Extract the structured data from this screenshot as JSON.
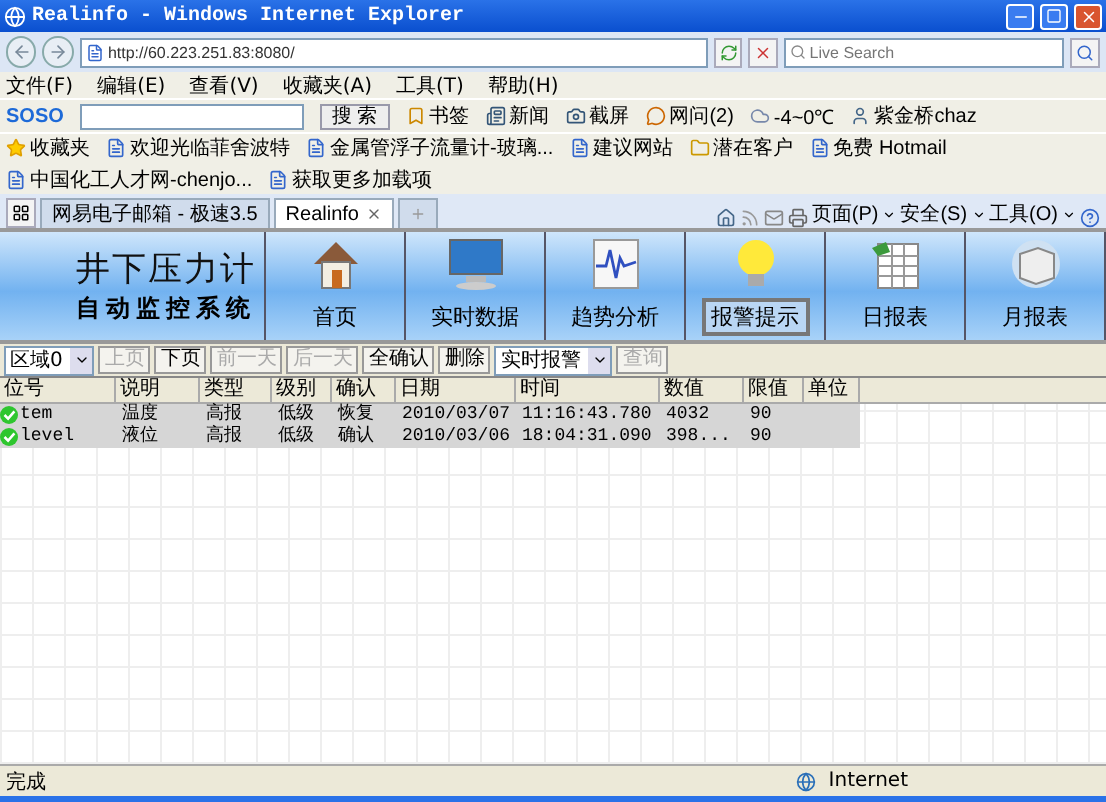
{
  "window": {
    "title": "Realinfo - Windows Internet Explorer"
  },
  "address_bar": {
    "url": "http://60.223.251.83:8080/",
    "search_placeholder": "Live Search"
  },
  "menu": [
    "文件(F)",
    "编辑(E)",
    "查看(V)",
    "收藏夹(A)",
    "工具(T)",
    "帮助(H)"
  ],
  "soso_toolbar": {
    "logo": "SOSO",
    "search_button": "搜 索",
    "items": [
      {
        "kind": "bookmark",
        "label": "书签"
      },
      {
        "kind": "news",
        "label": "新闻"
      },
      {
        "kind": "screenshot",
        "label": "截屏"
      },
      {
        "kind": "qa",
        "label": "网问(2)"
      },
      {
        "kind": "weather",
        "label": "-4~0℃"
      },
      {
        "kind": "user",
        "label": "紫金桥chaz"
      }
    ]
  },
  "favorites_bar": {
    "label": "收藏夹",
    "links": [
      {
        "kind": "page",
        "label": "欢迎光临菲舍波特"
      },
      {
        "kind": "page",
        "label": "金属管浮子流量计-玻璃..."
      },
      {
        "kind": "page",
        "label": "建议网站"
      },
      {
        "kind": "folder",
        "label": "潜在客户"
      },
      {
        "kind": "page",
        "label": "免费 Hotmail"
      },
      {
        "kind": "page",
        "label": "中国化工人才网-chenjo..."
      },
      {
        "kind": "page",
        "label": "获取更多加载项"
      }
    ]
  },
  "tabs": [
    {
      "label": "网易电子邮箱 - 极速3.5",
      "selected": false
    },
    {
      "label": "Realinfo",
      "selected": true
    }
  ],
  "command_bar": [
    "页面(P)",
    "安全(S)",
    "工具(O)"
  ],
  "app_header": {
    "title": "井下压力计",
    "subtitle": "自动监控系统",
    "nav": [
      {
        "kind": "home",
        "label": "首页",
        "selected": false
      },
      {
        "kind": "monitor",
        "label": "实时数据",
        "selected": false
      },
      {
        "kind": "trend",
        "label": "趋势分析",
        "selected": false
      },
      {
        "kind": "alarm",
        "label": "报警提示",
        "selected": true
      },
      {
        "kind": "daily",
        "label": "日报表",
        "selected": false
      },
      {
        "kind": "monthly",
        "label": "月报表",
        "selected": false
      }
    ]
  },
  "toolbar": [
    {
      "kind": "select",
      "value": "区域0"
    },
    {
      "kind": "button",
      "label": "上页",
      "disabled": true
    },
    {
      "kind": "button",
      "label": "下页",
      "disabled": false
    },
    {
      "kind": "button",
      "label": "前一天",
      "disabled": true
    },
    {
      "kind": "button",
      "label": "后一天",
      "disabled": true
    },
    {
      "kind": "button",
      "label": "全确认",
      "disabled": false
    },
    {
      "kind": "button",
      "label": "删除",
      "disabled": false
    },
    {
      "kind": "select",
      "value": "实时报警"
    },
    {
      "kind": "button",
      "label": "查询",
      "disabled": true
    }
  ],
  "table": {
    "columns": [
      "位号",
      "说明",
      "类型",
      "级别",
      "确认",
      "日期",
      "时间",
      "数值",
      "限值",
      "单位"
    ],
    "rows": [
      [
        "tem",
        "温度",
        "高报",
        "低级",
        "恢复",
        "2010/03/07",
        "11:16:43.780",
        "4032",
        "90"
      ],
      [
        "level",
        "液位",
        "高报",
        "低级",
        "确认",
        "2010/03/06",
        "18:04:31.090",
        "398...",
        "90"
      ]
    ]
  },
  "status_bar": {
    "text": "完成",
    "zone": "Internet"
  }
}
